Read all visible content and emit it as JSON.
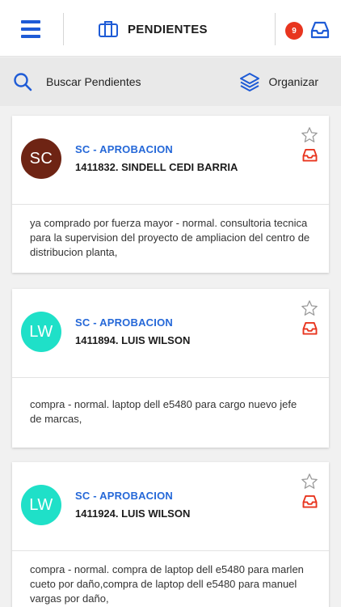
{
  "header": {
    "title": "PENDIENTES",
    "badge_count": "9"
  },
  "toolbar": {
    "search_label": "Buscar Pendientes",
    "organize_label": "Organizar"
  },
  "colors": {
    "accent": "#1e5bd6",
    "badge": "#e8351f",
    "type_text": "#2568d8",
    "tray_icon": "#e8351f"
  },
  "cards": [
    {
      "initials": "SC",
      "avatar_color": "#6e2414",
      "type": "SC - APROBACION",
      "name": "1411832. SINDELL CEDI BARRIA",
      "description": "ya comprado por fuerza mayor - normal. consultoria tecnica para la supervision del proyecto de ampliacion del centro de distribucion planta,"
    },
    {
      "initials": "LW",
      "avatar_color": "#1fe0c8",
      "type": "SC - APROBACION",
      "name": "1411894. LUIS WILSON",
      "description": "compra - normal. laptop dell e5480 para cargo nuevo jefe de marcas,"
    },
    {
      "initials": "LW",
      "avatar_color": "#1fe0c8",
      "type": "SC - APROBACION",
      "name": "1411924. LUIS WILSON",
      "description": "compra - normal. compra de laptop dell e5480 para marlen cueto por daño,compra de laptop dell e5480 para manuel vargas por daño,"
    }
  ]
}
